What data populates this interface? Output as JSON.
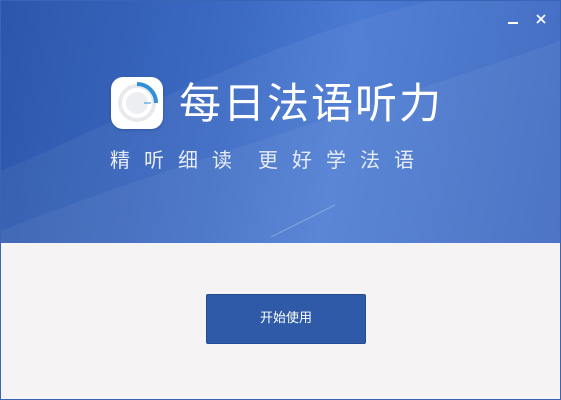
{
  "window": {
    "minimize_icon": "minimize-icon",
    "close_icon": "close-icon"
  },
  "banner": {
    "app_title": "每日法语听力",
    "slogan_part1": "精听细读",
    "slogan_part2": "更好学法语",
    "logo_icon": "app-logo-icon"
  },
  "main": {
    "start_button_label": "开始使用"
  },
  "colors": {
    "banner": "#3a66c0",
    "button": "#2f5aa8",
    "background": "#f5f3f4",
    "logo_accent": "#2f8fd8"
  }
}
